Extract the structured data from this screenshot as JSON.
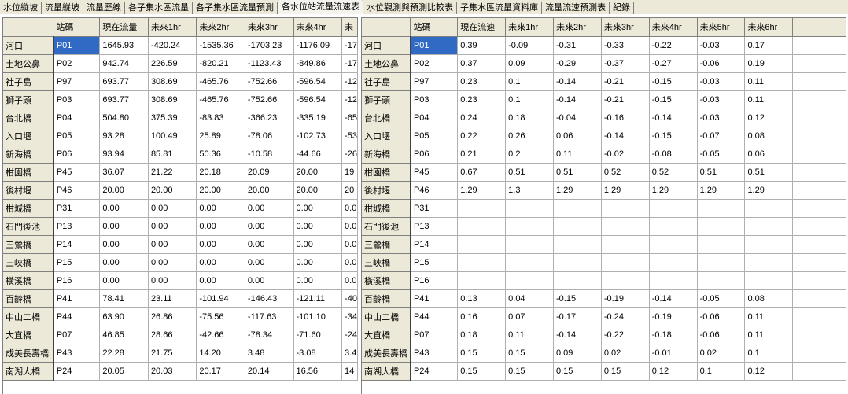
{
  "tabs": [
    {
      "label": "水位縱坡"
    },
    {
      "label": "流量縱坡"
    },
    {
      "label": "流量歷線"
    },
    {
      "label": "各子集水區流量"
    },
    {
      "label": "各子集水區流量預測"
    },
    {
      "label": "各水位站流量流速表"
    },
    {
      "label": "水位觀測與預測比較表"
    },
    {
      "label": "子集水區流量資料庫"
    },
    {
      "label": "流量流速預測表"
    },
    {
      "label": "紀錄"
    }
  ],
  "active_tab": 5,
  "flow_table": {
    "headers": [
      "",
      "站碼",
      "現在流量",
      "未來1hr",
      "未來2hr",
      "未來3hr",
      "未來4hr",
      "未"
    ],
    "rows": [
      [
        "河口",
        "P01",
        "1645.93",
        "-420.24",
        "-1535.36",
        "-1703.23",
        "-1176.09",
        "-17"
      ],
      [
        "土地公鼻",
        "P02",
        "942.74",
        "226.59",
        "-820.21",
        "-1123.43",
        "-849.86",
        "-17"
      ],
      [
        "社子島",
        "P97",
        "693.77",
        "308.69",
        "-465.76",
        "-752.66",
        "-596.54",
        "-12"
      ],
      [
        "獅子頭",
        "P03",
        "693.77",
        "308.69",
        "-465.76",
        "-752.66",
        "-596.54",
        "-12"
      ],
      [
        "台北橋",
        "P04",
        "504.80",
        "375.39",
        "-83.83",
        "-366.23",
        "-335.19",
        "-65"
      ],
      [
        "入口堰",
        "P05",
        "93.28",
        "100.49",
        "25.89",
        "-78.06",
        "-102.73",
        "-53"
      ],
      [
        "新海橋",
        "P06",
        "93.94",
        "85.81",
        "50.36",
        "-10.58",
        "-44.66",
        "-26"
      ],
      [
        "柑園橋",
        "P45",
        "36.07",
        "21.22",
        "20.18",
        "20.09",
        "20.00",
        "19"
      ],
      [
        "後村堰",
        "P46",
        "20.00",
        "20.00",
        "20.00",
        "20.00",
        "20.00",
        "20"
      ],
      [
        "柑城橋",
        "P31",
        "0.00",
        "0.00",
        "0.00",
        "0.00",
        "0.00",
        "0.0"
      ],
      [
        "石門後池",
        "P13",
        "0.00",
        "0.00",
        "0.00",
        "0.00",
        "0.00",
        "0.0"
      ],
      [
        "三鶯橋",
        "P14",
        "0.00",
        "0.00",
        "0.00",
        "0.00",
        "0.00",
        "0.0"
      ],
      [
        "三峽橋",
        "P15",
        "0.00",
        "0.00",
        "0.00",
        "0.00",
        "0.00",
        "0.0"
      ],
      [
        "橫溪橋",
        "P16",
        "0.00",
        "0.00",
        "0.00",
        "0.00",
        "0.00",
        "0.0"
      ],
      [
        "百齡橋",
        "P41",
        "78.41",
        "23.11",
        "-101.94",
        "-146.43",
        "-121.11",
        "-40"
      ],
      [
        "中山二橋",
        "P44",
        "63.90",
        "26.86",
        "-75.56",
        "-117.63",
        "-101.10",
        "-34"
      ],
      [
        "大直橋",
        "P07",
        "46.85",
        "28.66",
        "-42.66",
        "-78.34",
        "-71.60",
        "-24"
      ],
      [
        "成美長壽橋",
        "P43",
        "22.28",
        "21.75",
        "14.20",
        "3.48",
        "-3.08",
        "3.4"
      ],
      [
        "南湖大橋",
        "P24",
        "20.05",
        "20.03",
        "20.17",
        "20.14",
        "16.56",
        "14"
      ]
    ]
  },
  "velocity_table": {
    "headers": [
      "",
      "站碼",
      "現在流速",
      "未來1hr",
      "未來2hr",
      "未來3hr",
      "未來4hr",
      "未來5hr",
      "未來6hr",
      ""
    ],
    "rows": [
      [
        "河口",
        "P01",
        "0.39",
        "-0.09",
        "-0.31",
        "-0.33",
        "-0.22",
        "-0.03",
        "0.17",
        ""
      ],
      [
        "土地公鼻",
        "P02",
        "0.37",
        "0.09",
        "-0.29",
        "-0.37",
        "-0.27",
        "-0.06",
        "0.19",
        ""
      ],
      [
        "社子島",
        "P97",
        "0.23",
        "0.1",
        "-0.14",
        "-0.21",
        "-0.15",
        "-0.03",
        "0.11",
        ""
      ],
      [
        "獅子頭",
        "P03",
        "0.23",
        "0.1",
        "-0.14",
        "-0.21",
        "-0.15",
        "-0.03",
        "0.11",
        ""
      ],
      [
        "台北橋",
        "P04",
        "0.24",
        "0.18",
        "-0.04",
        "-0.16",
        "-0.14",
        "-0.03",
        "0.12",
        ""
      ],
      [
        "入口堰",
        "P05",
        "0.22",
        "0.26",
        "0.06",
        "-0.14",
        "-0.15",
        "-0.07",
        "0.08",
        ""
      ],
      [
        "新海橋",
        "P06",
        "0.21",
        "0.2",
        "0.11",
        "-0.02",
        "-0.08",
        "-0.05",
        "0.06",
        ""
      ],
      [
        "柑園橋",
        "P45",
        "0.67",
        "0.51",
        "0.51",
        "0.52",
        "0.52",
        "0.51",
        "0.51",
        ""
      ],
      [
        "後村堰",
        "P46",
        "1.29",
        "1.3",
        "1.29",
        "1.29",
        "1.29",
        "1.29",
        "1.29",
        ""
      ],
      [
        "柑城橋",
        "P31",
        "",
        "",
        "",
        "",
        "",
        "",
        "",
        ""
      ],
      [
        "石門後池",
        "P13",
        "",
        "",
        "",
        "",
        "",
        "",
        "",
        ""
      ],
      [
        "三鶯橋",
        "P14",
        "",
        "",
        "",
        "",
        "",
        "",
        "",
        ""
      ],
      [
        "三峽橋",
        "P15",
        "",
        "",
        "",
        "",
        "",
        "",
        "",
        ""
      ],
      [
        "橫溪橋",
        "P16",
        "",
        "",
        "",
        "",
        "",
        "",
        "",
        ""
      ],
      [
        "百齡橋",
        "P41",
        "0.13",
        "0.04",
        "-0.15",
        "-0.19",
        "-0.14",
        "-0.05",
        "0.08",
        ""
      ],
      [
        "中山二橋",
        "P44",
        "0.16",
        "0.07",
        "-0.17",
        "-0.24",
        "-0.19",
        "-0.06",
        "0.11",
        ""
      ],
      [
        "大直橋",
        "P07",
        "0.18",
        "0.11",
        "-0.14",
        "-0.22",
        "-0.18",
        "-0.06",
        "0.11",
        ""
      ],
      [
        "成美長壽橋",
        "P43",
        "0.15",
        "0.15",
        "0.09",
        "0.02",
        "-0.01",
        "0.02",
        "0.1",
        ""
      ],
      [
        "南湖大橋",
        "P24",
        "0.15",
        "0.15",
        "0.15",
        "0.15",
        "0.12",
        "0.1",
        "0.12",
        ""
      ]
    ]
  },
  "colors": {
    "selection": "#316ac5",
    "header_bg": "#ece9d8"
  }
}
